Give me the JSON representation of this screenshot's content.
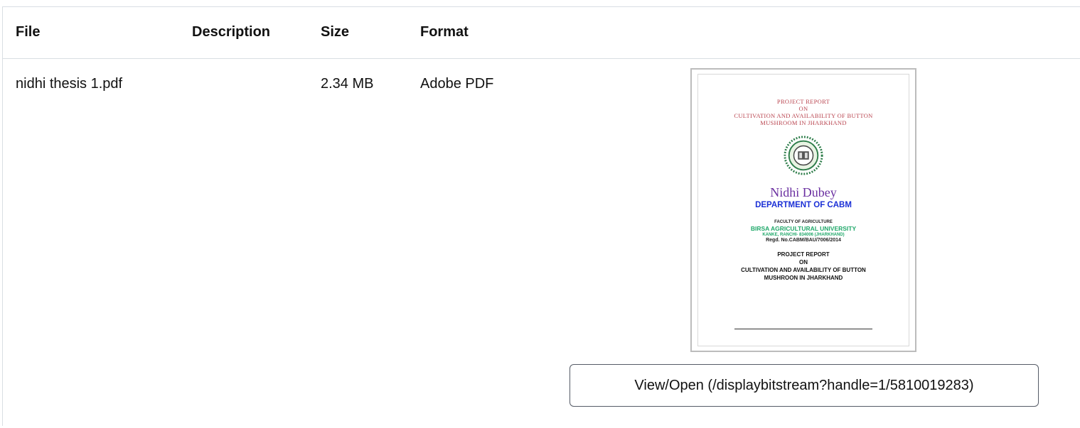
{
  "table": {
    "headers": {
      "file": "File",
      "description": "Description",
      "size": "Size",
      "format": "Format"
    },
    "rows": [
      {
        "file": "nidhi thesis 1.pdf",
        "description": "",
        "size": "2.34 MB",
        "format": "Adobe PDF",
        "view_label": "View/Open (/displaybitstream?handle=1/5810019283)"
      }
    ]
  },
  "thumbnail": {
    "title_lines": [
      "PROJECT REPORT",
      "ON",
      "CULTIVATION AND AVAILABILITY OF BUTTON",
      "MUSHROOM IN JHARKHAND"
    ],
    "author": "Nidhi Dubey",
    "department": "DEPARTMENT OF CABM",
    "faculty": "FACULTY OF AGRICULTURE",
    "university": "BIRSA AGRICULTURAL UNIVERSITY",
    "address": "KANKE, RANCHI- 834006 (JHARKHAND)",
    "regd": "Regd. No.CABM/BAU/7006/2014",
    "repeat_lines": [
      "PROJECT REPORT",
      "ON",
      "CULTIVATION AND AVAILABILITY OF BUTTON",
      "MUSHROON IN JHARKHAND"
    ]
  },
  "colors": {
    "border": "#d9dee3",
    "button_border": "#555b66",
    "thumb_red": "#b9444f",
    "thumb_purple": "#6a2fa0",
    "thumb_blue": "#1a2fd6",
    "thumb_green": "#20a86a"
  }
}
